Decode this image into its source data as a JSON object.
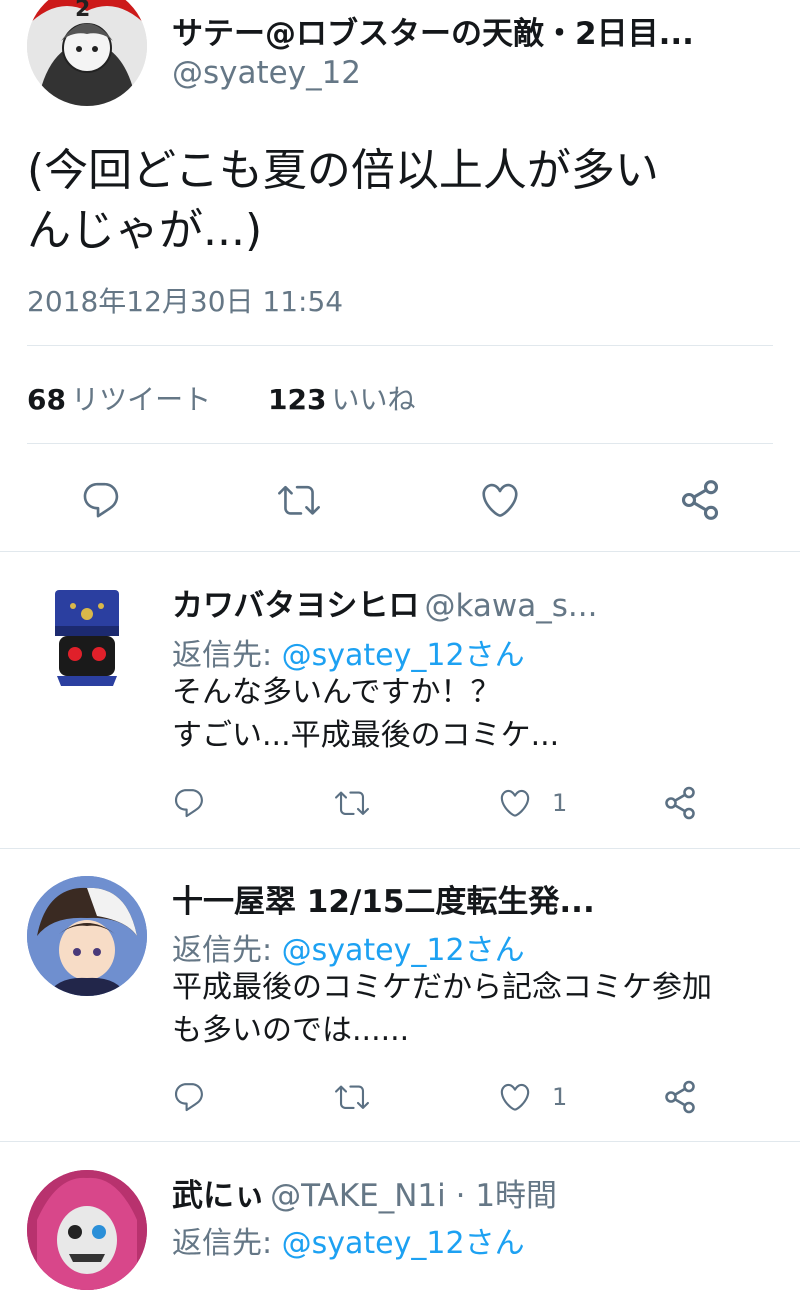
{
  "main_tweet": {
    "display_name": "サテー@ロブスターの天敵・2日目...",
    "handle": "@syatey_12",
    "text_line1": "(今回どこも夏の倍以上人が多い",
    "text_line2": "んじゃが...)",
    "timestamp": "2018年12月30日 11:54",
    "retweet_count": "68",
    "retweet_label": "リツイート",
    "like_count": "123",
    "like_label": "いいね"
  },
  "replies": [
    {
      "display_name": "カワバタヨシヒロ",
      "handle": "@kawa_s...",
      "reply_prefix": "返信先:",
      "reply_mention": "@syatey_12さん",
      "text_line1": "そんな多いんですか！？",
      "text_line2": "すごい...平成最後のコミケ...",
      "like_count": "1"
    },
    {
      "display_name": "十一屋翠 12/15二度転生発...",
      "handle": "",
      "reply_prefix": "返信先:",
      "reply_mention": "@syatey_12さん",
      "text_line1": "平成最後のコミケだから記念コミケ参加",
      "text_line2": "も多いのでは......",
      "like_count": "1"
    },
    {
      "display_name": "武にぃ",
      "handle": "@TAKE_N1i · 1時間",
      "reply_prefix": "返信先:",
      "reply_mention": "@syatey_12さん"
    }
  ],
  "icons": {
    "reply": "reply-icon",
    "retweet": "retweet-icon",
    "like": "heart-icon",
    "share": "share-icon"
  },
  "colors": {
    "accent": "#1da1f2",
    "secondary_text": "#657786",
    "icon": "#5b7083",
    "divider": "#e1e8ed"
  }
}
